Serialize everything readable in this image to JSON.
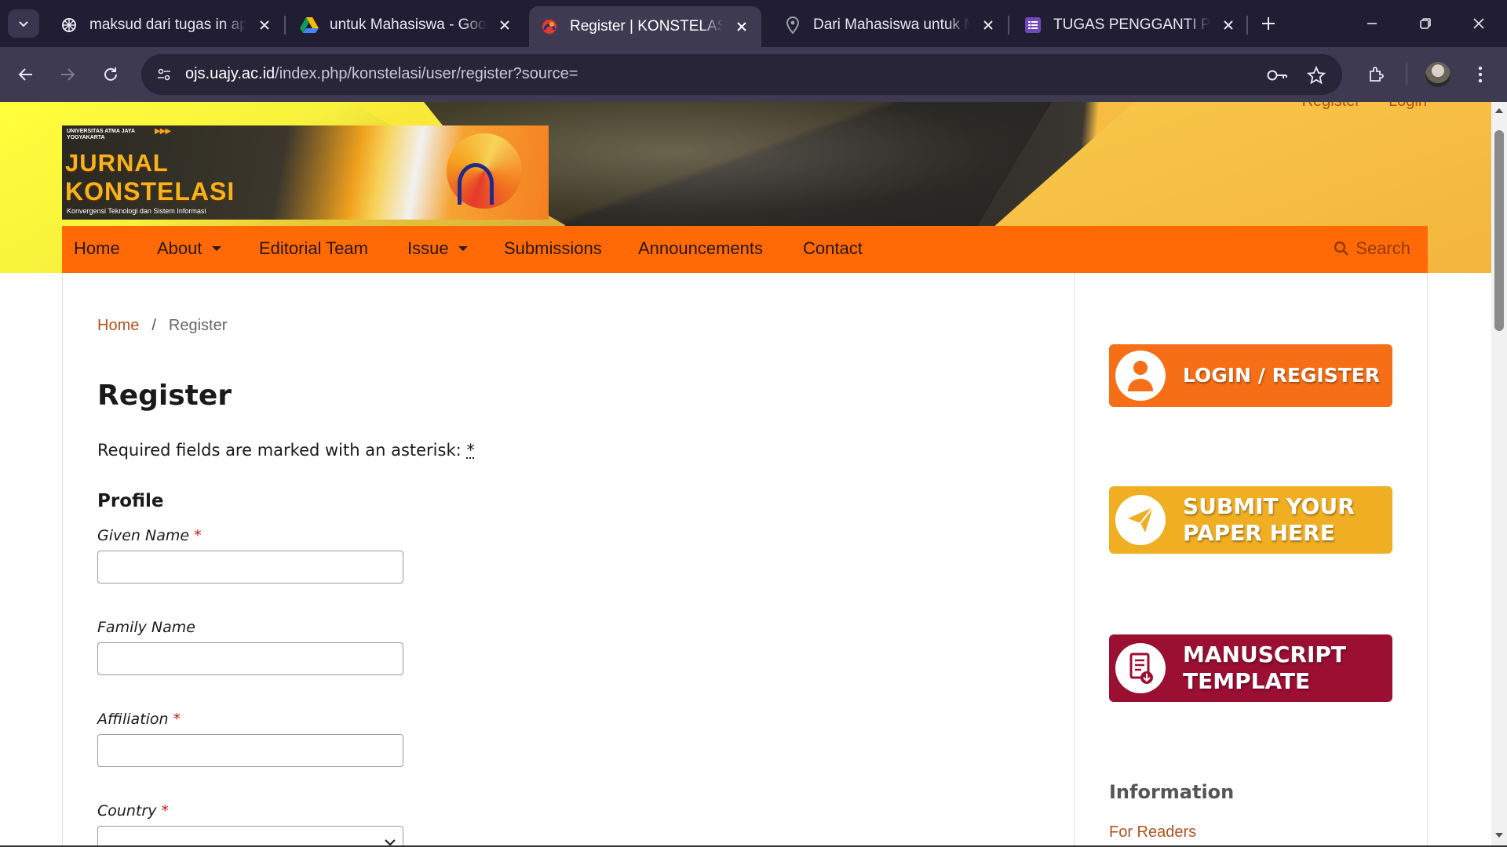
{
  "browser": {
    "tabs": [
      {
        "title": "maksud dari tugas in apa",
        "icon": "ai-assistant-icon",
        "active": false
      },
      {
        "title": "untuk Mahasiswa - Goog",
        "icon": "google-drive-icon",
        "active": false
      },
      {
        "title": "Register | KONSTELASI: K",
        "icon": "konstelasi-favicon",
        "active": true
      },
      {
        "title": "Dari Mahasiswa untuk M",
        "icon": "location-pin-icon",
        "active": false
      },
      {
        "title": "TUGAS PENGGANTI PERT",
        "icon": "google-forms-icon",
        "active": false
      }
    ],
    "url_host": "ojs.uajy.ac.id",
    "url_path": "/index.php/konstelasi/user/register?source="
  },
  "header": {
    "links": [
      "Register",
      "Login"
    ],
    "logo": {
      "university": "UNIVERSITAS ATMA JAYA YOGYAKARTA",
      "title_line1": "JURNAL",
      "title_line2": "KONSTELASI",
      "subtitle": "Konvergensi Teknologi dan Sistem Informasi"
    }
  },
  "nav": {
    "items": [
      "Home",
      "About",
      "Editorial Team",
      "Issue",
      "Submissions",
      "Announcements",
      "Contact"
    ],
    "search": "Search"
  },
  "breadcrumb": {
    "home": "Home",
    "separator": "/",
    "current": "Register"
  },
  "form": {
    "title": "Register",
    "required_note": "Required fields are marked with an asterisk:",
    "required_mark": "*",
    "section": "Profile",
    "fields": [
      {
        "label": "Given Name",
        "required": true,
        "value": ""
      },
      {
        "label": "Family Name",
        "required": false,
        "value": ""
      },
      {
        "label": "Affiliation",
        "required": true,
        "value": ""
      },
      {
        "label": "Country",
        "required": true,
        "value": ""
      }
    ]
  },
  "sidebar": {
    "login_banner": "LOGIN / REGISTER",
    "submit_banner_line1": "SUBMIT YOUR",
    "submit_banner_line2": "PAPER HERE",
    "manuscript_banner_line1": "MANUSCRIPT",
    "manuscript_banner_line2": "TEMPLATE",
    "info_heading": "Information",
    "info_link": "For Readers"
  },
  "colors": {
    "nav_bg": "#ff6a06",
    "link": "#b3521d",
    "required": "#c4161c",
    "login_banner": "#f66f16",
    "submit_banner": "#f0ae22",
    "manuscript_banner": "#9a0f32"
  }
}
